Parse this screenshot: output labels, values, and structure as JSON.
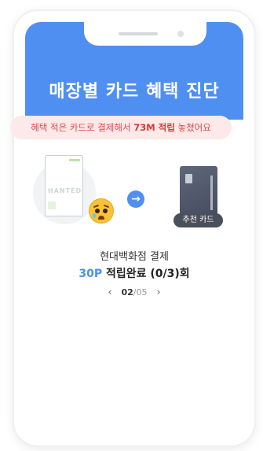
{
  "header": {
    "title": "매장별 카드 혜택 진단"
  },
  "alert": {
    "prefix": "혜택 적은 카드로 결제해서 ",
    "amount": "73M 적립",
    "suffix": " 놓쳤어요"
  },
  "cards": {
    "current_brand": "HANTED",
    "recommend_label": "추천 카드"
  },
  "detail": {
    "store": "현대백화점 결제",
    "points": "30P",
    "status": "적립완료 (0/3)회"
  },
  "pager": {
    "current": "02",
    "separator": "/",
    "total": "05"
  },
  "icons": {
    "prev": "chevron-left-icon",
    "next": "chevron-right-icon",
    "arrow": "arrow-right-icon",
    "emoji": "crying-face-icon"
  },
  "colors": {
    "accent": "#4f8ff2",
    "alert_text": "#e04848",
    "alert_bg": "#fde9e9"
  }
}
